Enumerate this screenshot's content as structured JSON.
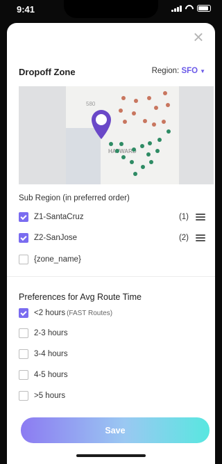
{
  "status": {
    "time": "9:41"
  },
  "dropoff": {
    "title": "Dropoff Zone",
    "region_label": "Region:",
    "region_value": "SFO"
  },
  "map": {
    "labels": [
      "580",
      "HAYWARD"
    ]
  },
  "subregion": {
    "title": "Sub Region (in preferred order)",
    "items": [
      {
        "label": "Z1-SantaCruz",
        "checked": true,
        "rank": "(1)"
      },
      {
        "label": "Z2-SanJose",
        "checked": true,
        "rank": "(2)"
      },
      {
        "label": "{zone_name}",
        "checked": false
      }
    ]
  },
  "preferences": {
    "title": "Preferences for Avg Route Time",
    "options": [
      {
        "label": "<2 hours",
        "sub": "(FAST Routes)",
        "checked": true
      },
      {
        "label": "2-3 hours",
        "checked": false
      },
      {
        "label": "3-4 hours",
        "checked": false
      },
      {
        "label": "4-5 hours",
        "checked": false
      },
      {
        "label": ">5 hours",
        "checked": false
      }
    ]
  },
  "actions": {
    "save_label": "Save"
  },
  "colors": {
    "accent": "#6a59e8",
    "map_red": "#c8765f",
    "map_green": "#2e8b64"
  }
}
